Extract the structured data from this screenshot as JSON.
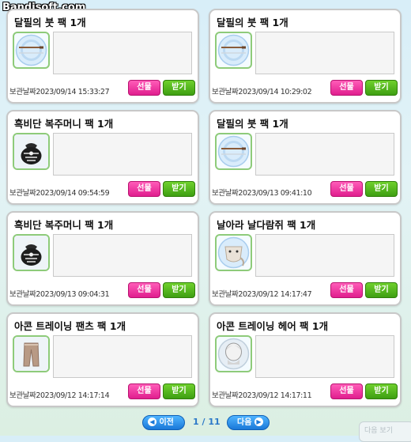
{
  "watermark": "Bandisoft.com",
  "labels": {
    "date_label": "보관날짜",
    "gift_button": "선물",
    "receive_button": "받기"
  },
  "cards": [
    {
      "title": "달필의 붓 팩 1개",
      "date": "2023/09/14 15:33:27",
      "icon": "brush-icon"
    },
    {
      "title": "달필의 붓 팩 1개",
      "date": "2023/09/14 10:29:02",
      "icon": "brush-icon"
    },
    {
      "title": "흑비단 복주머니 팩 1개",
      "date": "2023/09/14 09:54:59",
      "icon": "lucky-pouch-icon"
    },
    {
      "title": "달필의 붓 팩 1개",
      "date": "2023/09/13 09:41:10",
      "icon": "brush-icon"
    },
    {
      "title": "흑비단 복주머니 팩 1개",
      "date": "2023/09/13 09:04:31",
      "icon": "lucky-pouch-icon"
    },
    {
      "title": "날아라 날다람쥐 팩 1개",
      "date": "2023/09/12 14:17:47",
      "icon": "flying-squirrel-icon"
    },
    {
      "title": "아콘 트레이닝 팬츠 팩 1개",
      "date": "2023/09/12 14:17:14",
      "icon": "training-pants-icon"
    },
    {
      "title": "아콘 트레이닝 헤어 팩 1개",
      "date": "2023/09/12 14:17:11",
      "icon": "training-hair-icon"
    }
  ],
  "pagination": {
    "prev_label": "이전",
    "next_label": "다음",
    "current_page": "1",
    "total_pages": "11",
    "separator": "/"
  },
  "corner_text": "다음 보기"
}
